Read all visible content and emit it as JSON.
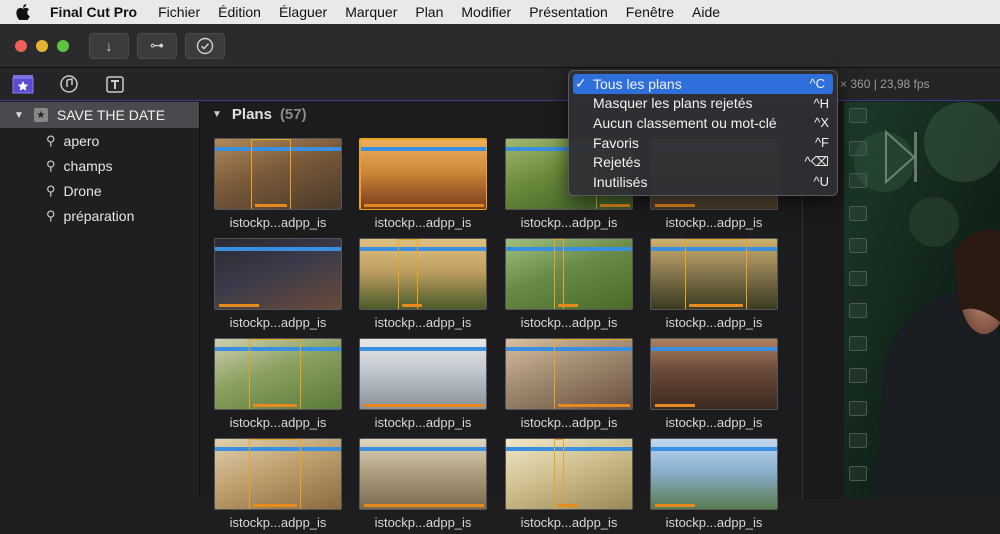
{
  "menubar": {
    "apple_icon": "apple-logo",
    "app_name": "Final Cut Pro",
    "items": [
      "Fichier",
      "Édition",
      "Élaguer",
      "Marquer",
      "Plan",
      "Modifier",
      "Présentation",
      "Fenêtre",
      "Aide"
    ]
  },
  "toolbar": {
    "traffic_colors": [
      "#ed5f57",
      "#e5b32f",
      "#5cc43f"
    ],
    "buttons": [
      {
        "icon": "download-arrow-icon",
        "glyph": "↓"
      },
      {
        "icon": "key-icon",
        "glyph": "⊶"
      },
      {
        "icon": "checkmark-circle-icon",
        "glyph": "✓"
      }
    ]
  },
  "subbar": {
    "icons": [
      "libraries-icon",
      "photos-audio-icon",
      "titles-generators-icon"
    ],
    "fps_info": "× 360 | 23,98 fps"
  },
  "sidebar": {
    "library": "SAVE THE DATE",
    "events": [
      "apero",
      "champs",
      "Drone",
      "préparation"
    ]
  },
  "browser": {
    "title": "Plans",
    "count": "(57)",
    "clip_label": "istockp...adpp_is"
  },
  "menu": {
    "items": [
      {
        "label": "Tous les plans",
        "shortcut": "^C",
        "checked": true,
        "highlighted": true
      },
      {
        "label": "Masquer les plans rejetés",
        "shortcut": "^H",
        "checked": false,
        "highlighted": false
      },
      {
        "label": "Aucun classement ou mot-clé",
        "shortcut": "^X",
        "checked": false,
        "highlighted": false
      },
      {
        "label": "Favoris",
        "shortcut": "^F",
        "checked": false,
        "highlighted": false
      },
      {
        "label": "Rejetés",
        "shortcut": "^⌫",
        "checked": false,
        "highlighted": false
      },
      {
        "label": "Inutilisés",
        "shortcut": "^U",
        "checked": false,
        "highlighted": false
      }
    ]
  },
  "colors": {
    "accent_blue": "#2f6fdc",
    "clip_blue_line": "#3a8fe0",
    "selection_orange": "#e6a623"
  }
}
